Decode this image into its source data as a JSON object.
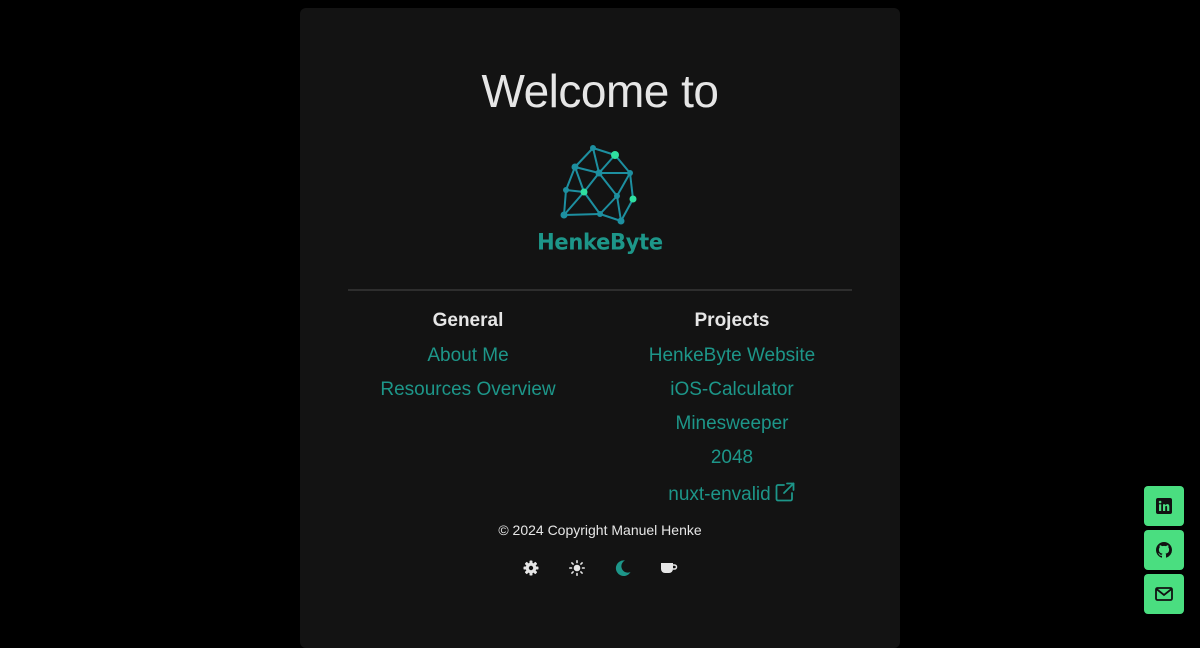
{
  "header": {
    "welcome": "Welcome to"
  },
  "logo": {
    "text": "HenkeByte"
  },
  "general": {
    "title": "General",
    "links": [
      {
        "label": "About Me"
      },
      {
        "label": "Resources Overview"
      }
    ]
  },
  "projects": {
    "title": "Projects",
    "links": [
      {
        "label": "HenkeByte Website"
      },
      {
        "label": "iOS-Calculator"
      },
      {
        "label": "Minesweeper"
      },
      {
        "label": "2048"
      },
      {
        "label": "nuxt-envalid",
        "icon": "external-link-icon"
      }
    ]
  },
  "footer": {
    "copyright": "© 2024 Copyright Manuel Henke"
  },
  "themes": [
    {
      "icon": "gear-icon",
      "active": false
    },
    {
      "icon": "sun-icon",
      "active": false
    },
    {
      "icon": "moon-icon",
      "active": true
    },
    {
      "icon": "coffee-cup-icon",
      "active": false
    }
  ],
  "social": [
    {
      "icon": "linkedin-icon"
    },
    {
      "icon": "github-icon"
    },
    {
      "icon": "mail-icon"
    }
  ],
  "colors": {
    "background": "#000000",
    "card": "#131313",
    "accent": "#1d9689",
    "text": "#e6e6e6",
    "social_button": "#4ade80"
  }
}
